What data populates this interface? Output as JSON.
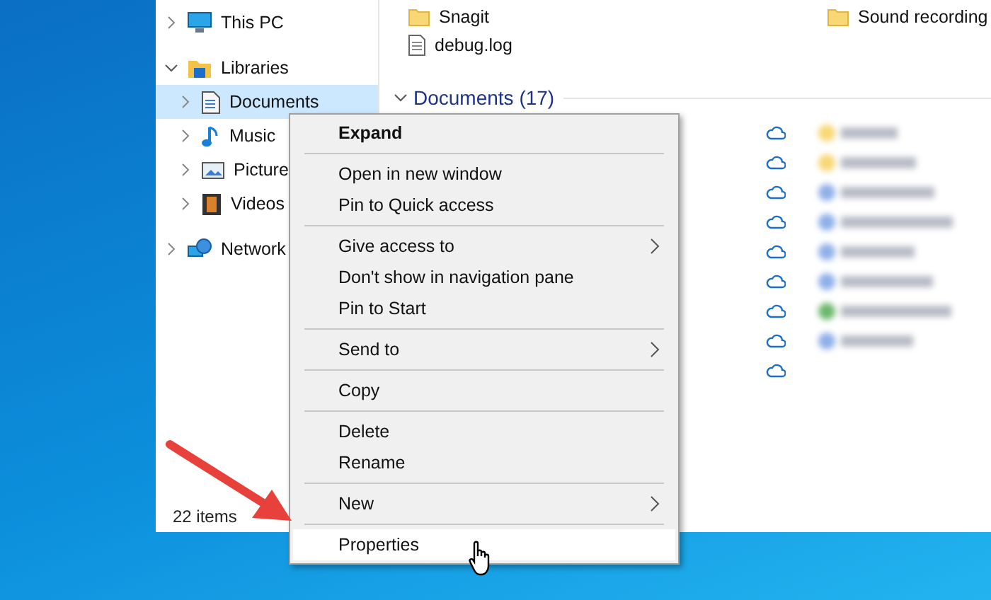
{
  "navigation_pane": {
    "items": [
      {
        "label": "This PC",
        "kind": "pc",
        "expanded": false,
        "selected": false
      },
      {
        "label": "Libraries",
        "kind": "library",
        "expanded": true,
        "selected": false,
        "children": [
          {
            "label": "Documents",
            "kind": "document",
            "expanded": false,
            "selected": true
          },
          {
            "label": "Music",
            "kind": "music",
            "expanded": false,
            "selected": false
          },
          {
            "label": "Picture",
            "kind": "picture",
            "expanded": false,
            "selected": false
          },
          {
            "label": "Videos",
            "kind": "video",
            "expanded": false,
            "selected": false
          }
        ]
      },
      {
        "label": "Network",
        "kind": "network",
        "expanded": false,
        "selected": false
      }
    ]
  },
  "content": {
    "files": [
      {
        "name": "Snagit",
        "kind": "folder"
      },
      {
        "name": "debug.log",
        "kind": "file"
      },
      {
        "name": "Sound recording",
        "kind": "folder"
      }
    ],
    "group_header": {
      "label": "Documents (17)",
      "expanded": true
    }
  },
  "status_bar": {
    "item_count": "22 items"
  },
  "context_menu": {
    "items": [
      {
        "kind": "item",
        "label": "Expand",
        "bold": true,
        "submenu": false,
        "hovered": false
      },
      {
        "kind": "separator"
      },
      {
        "kind": "item",
        "label": "Open in new window",
        "bold": false,
        "submenu": false,
        "hovered": false
      },
      {
        "kind": "item",
        "label": "Pin to Quick access",
        "bold": false,
        "submenu": false,
        "hovered": false
      },
      {
        "kind": "separator"
      },
      {
        "kind": "item",
        "label": "Give access to",
        "bold": false,
        "submenu": true,
        "hovered": false
      },
      {
        "kind": "item",
        "label": "Don't show in navigation pane",
        "bold": false,
        "submenu": false,
        "hovered": false
      },
      {
        "kind": "item",
        "label": "Pin to Start",
        "bold": false,
        "submenu": false,
        "hovered": false
      },
      {
        "kind": "separator"
      },
      {
        "kind": "item",
        "label": "Send to",
        "bold": false,
        "submenu": true,
        "hovered": false
      },
      {
        "kind": "separator"
      },
      {
        "kind": "item",
        "label": "Copy",
        "bold": false,
        "submenu": false,
        "hovered": false
      },
      {
        "kind": "separator"
      },
      {
        "kind": "item",
        "label": "Delete",
        "bold": false,
        "submenu": false,
        "hovered": false
      },
      {
        "kind": "item",
        "label": "Rename",
        "bold": false,
        "submenu": false,
        "hovered": false
      },
      {
        "kind": "separator"
      },
      {
        "kind": "item",
        "label": "New",
        "bold": false,
        "submenu": true,
        "hovered": false
      },
      {
        "kind": "separator"
      },
      {
        "kind": "item",
        "label": "Properties",
        "bold": false,
        "submenu": false,
        "hovered": true
      }
    ]
  }
}
